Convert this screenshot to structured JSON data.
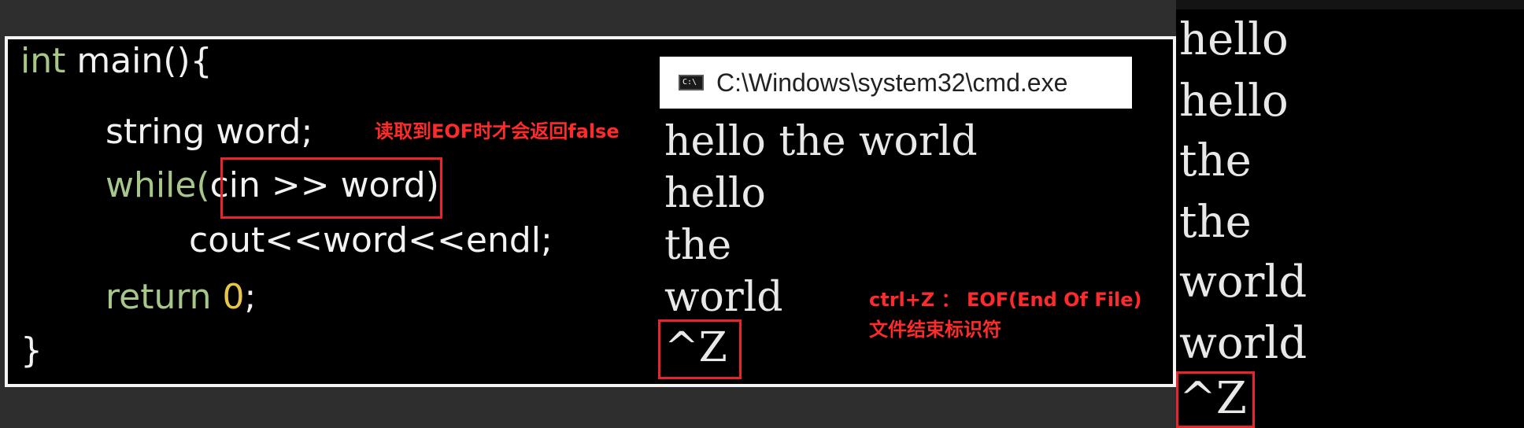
{
  "code": {
    "line1_kw": "int",
    "line1_rest": " main(){",
    "line2": "string word;",
    "line3_kw": "while(",
    "line3_inner": "cin >> word",
    "line3_end": ")",
    "line4": "cout<<word<<endl;",
    "line5_kw": "return",
    "line5_num": "0",
    "line5_end": ";",
    "line6": "}"
  },
  "annotations": {
    "eof_note": "读取到EOF时才会返回false",
    "ctrl_z_line1": "ctrl+Z ： EOF(End Of File)",
    "ctrl_z_line2": "文件结束标识符"
  },
  "cmd_window": {
    "icon_text": "C:\\",
    "title": "C:\\Windows\\system32\\cmd.exe",
    "lines": [
      "hello the world",
      "hello",
      "the",
      "world",
      "^Z"
    ]
  },
  "right_console": {
    "lines": [
      "hello",
      "hello",
      "the",
      "the",
      "world",
      "world",
      "^Z"
    ]
  },
  "colors": {
    "keyword": "#a6c68a",
    "number": "#e6c54a",
    "highlight": "#e8252a",
    "annotation": "#ff2b2b"
  }
}
